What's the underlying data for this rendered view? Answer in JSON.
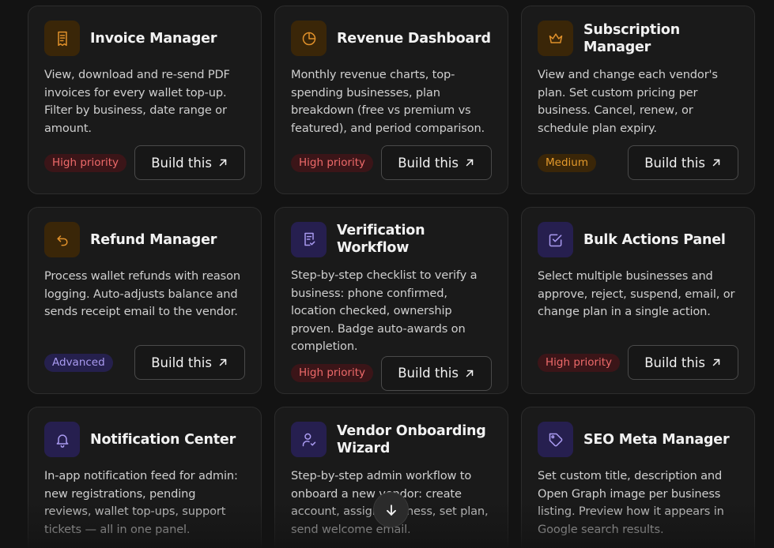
{
  "build_label": "Build this",
  "cards": [
    {
      "title": "Invoice Manager",
      "desc": "View, download and re-send PDF invoices for every wallet top-up. Filter by business, date range or amount.",
      "badge": "High priority",
      "icon": "receipt-icon",
      "tone": "amber"
    },
    {
      "title": "Revenue Dashboard",
      "desc": "Monthly revenue charts, top-spending businesses, plan breakdown (free vs premium vs featured), and period comparison.",
      "badge": "High priority",
      "icon": "pie-chart-icon",
      "tone": "amber"
    },
    {
      "title": "Subscription Manager",
      "desc": "View and change each vendor's plan. Set custom pricing per business. Cancel, renew, or schedule plan expiry.",
      "badge": "Medium",
      "icon": "crown-icon",
      "tone": "amber"
    },
    {
      "title": "Refund Manager",
      "desc": "Process wallet refunds with reason logging. Auto-adjusts balance and sends receipt email to the vendor.",
      "badge": "Advanced",
      "icon": "undo-arrow-icon",
      "tone": "amber"
    },
    {
      "title": "Verification Workflow",
      "desc": "Step-by-step checklist to verify a business: phone confirmed, location checked, ownership proven. Badge auto-awards on completion.",
      "badge": "High priority",
      "icon": "file-check-icon",
      "tone": "violet"
    },
    {
      "title": "Bulk Actions Panel",
      "desc": "Select multiple businesses and approve, reject, suspend, email, or change plan in a single action.",
      "badge": "High priority",
      "icon": "checkbox-icon",
      "tone": "violet"
    },
    {
      "title": "Notification Center",
      "desc": "In-app notification feed for admin: new registrations, pending reviews, wallet top-ups, support tickets — all in one panel.",
      "icon": "bell-icon",
      "tone": "violet"
    },
    {
      "title": "Vendor Onboarding Wizard",
      "desc": "Step-by-step admin workflow to onboard a new vendor: create account, assign business, set plan, send welcome email.",
      "icon": "user-check-icon",
      "tone": "violet"
    },
    {
      "title": "SEO Meta Manager",
      "desc": "Set custom title, description and Open Graph image per business listing. Preview how it appears in Google search results.",
      "icon": "tag-icon",
      "tone": "violet"
    }
  ]
}
